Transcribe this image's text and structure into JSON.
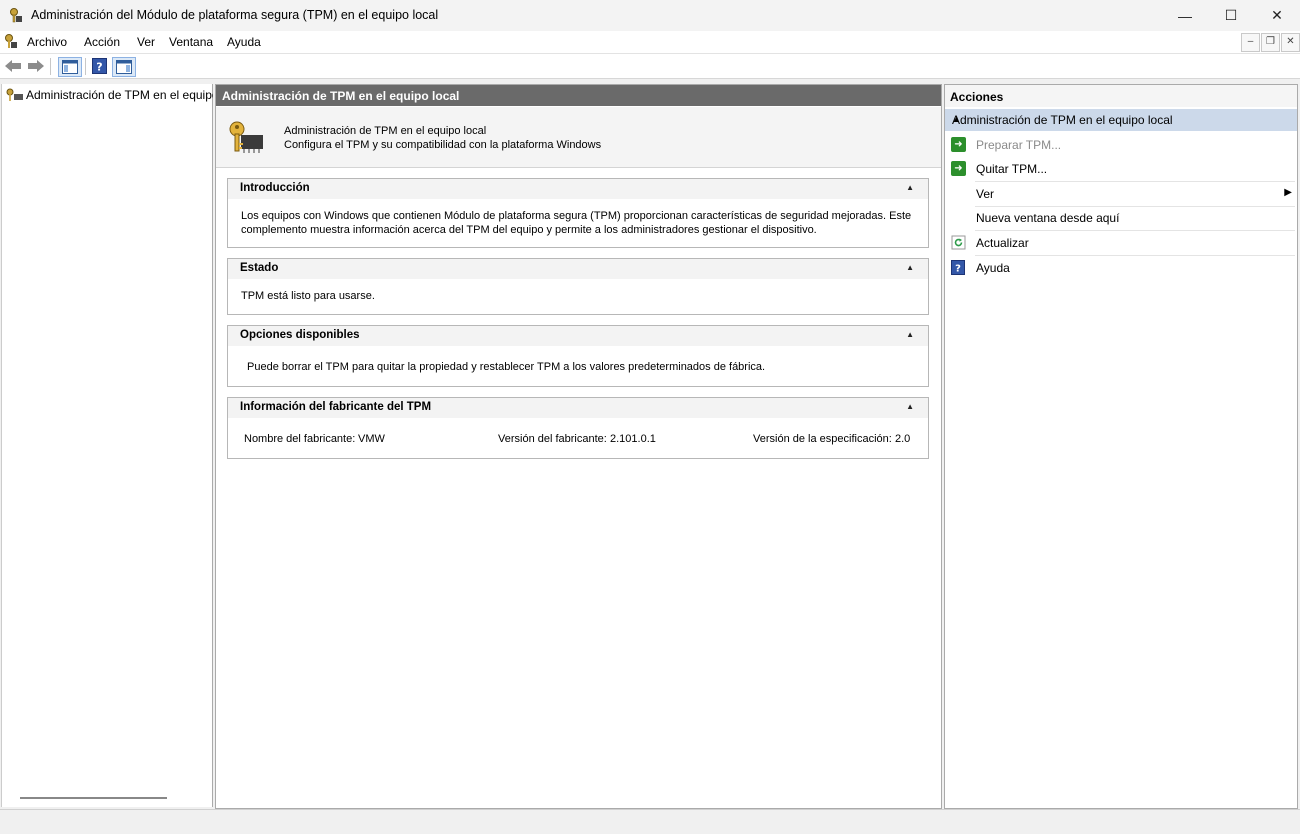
{
  "window": {
    "title": "Administración del Módulo de plataforma segura (TPM) en el equipo local",
    "minimize": "—",
    "maximize": "☐",
    "close": "✕"
  },
  "menu": {
    "items": [
      "Archivo",
      "Acción",
      "Ver",
      "Ventana",
      "Ayuda"
    ]
  },
  "tree": {
    "root": "Administración de TPM en el equipo local"
  },
  "center": {
    "header": "Administración de TPM en el equipo local",
    "intro_title": "Administración de TPM en el equipo local",
    "intro_subtitle": "Configura el TPM y su compatibilidad con la plataforma Windows",
    "sections": {
      "introduccion": {
        "title": "Introducción",
        "line1": "Los equipos con Windows que contienen Módulo de plataforma segura (TPM) proporcionan características de seguridad mejoradas. Este",
        "line2": "complemento muestra información acerca del TPM del equipo y permite a los administradores gestionar el dispositivo."
      },
      "estado": {
        "title": "Estado",
        "text": "TPM está listo para usarse."
      },
      "opciones": {
        "title": "Opciones disponibles",
        "text": "Puede borrar el TPM para quitar la propiedad y restablecer TPM a los valores predeterminados de fábrica."
      },
      "fabricante": {
        "title": "Información del fabricante del TPM",
        "name_label": "Nombre del fabricante:",
        "name_value": "VMW",
        "version_label": "Versión del fabricante:",
        "version_value": "2.101.0.1",
        "spec_label": "Versión de la especificación:",
        "spec_value": "2.0"
      }
    }
  },
  "actions": {
    "header": "Acciones",
    "subheader": "Administración de TPM en el equipo local",
    "items": {
      "preparar": "Preparar TPM...",
      "quitar": "Quitar TPM...",
      "ver": "Ver",
      "nueva": "Nueva ventana desde aquí",
      "actualizar": "Actualizar",
      "ayuda": "Ayuda"
    }
  },
  "colors": {
    "header_bg": "#6a6a6a",
    "actions_selected_bg": "#ccd9ea",
    "disabled_text": "#8a8a8a"
  }
}
